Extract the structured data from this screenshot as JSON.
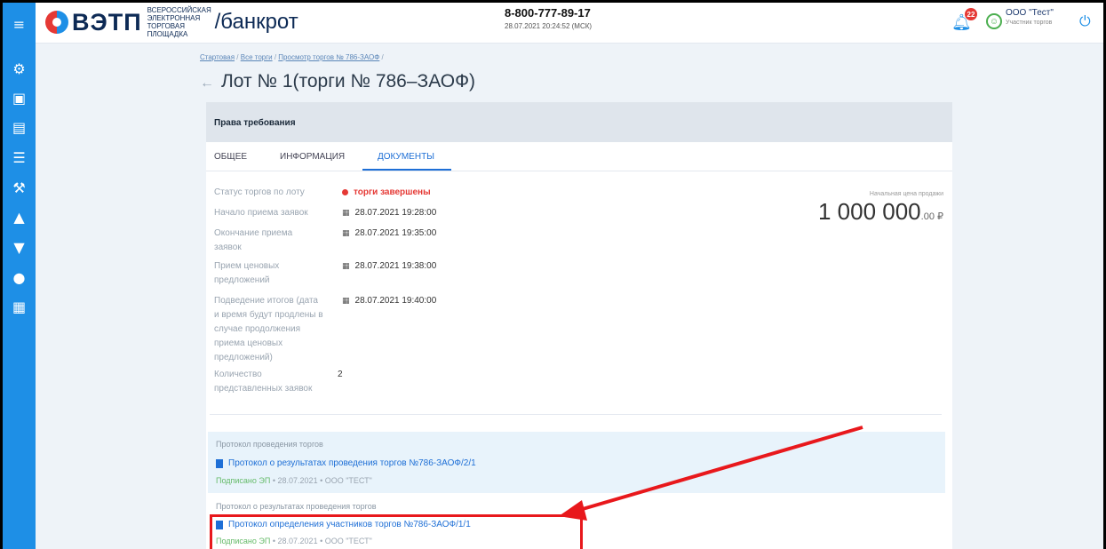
{
  "header": {
    "logo_text": "ВЭТП",
    "logo_sub": "ВСЕРОССИЙСКАЯ ЭЛЕКТРОННАЯ ТОРГОВАЯ ПЛОЩАДКА",
    "logo_section": "/банкрот",
    "phone": "8-800-777-89-17",
    "datetime": "28.07.2021 20:24:52 (МСК)",
    "notifications_count": "22",
    "user_name": "ООО \"Тест\"",
    "user_role": "Участник торгов"
  },
  "sidebar": {
    "icons": [
      "menu-icon",
      "settings-icon",
      "document-icon",
      "scroll-icon",
      "list-icon",
      "gavel-icon",
      "auction-icon",
      "auction2-icon",
      "money-bag-icon",
      "contacts-icon"
    ]
  },
  "breadcrumb": {
    "items": [
      "Стартовая",
      "Все торги",
      "Просмотр торгов № 786-ЗАОФ"
    ]
  },
  "page": {
    "title": "Лот № 1(торги № 786–ЗАОФ)"
  },
  "card": {
    "header": "Права требования",
    "tabs": [
      "ОБЩЕЕ",
      "ИНФОРМАЦИЯ",
      "ДОКУМЕНТЫ"
    ],
    "active_tab": 2,
    "fields": [
      {
        "label": "Статус торгов по лоту",
        "value": "торги завершены"
      },
      {
        "label": "Начало приема заявок",
        "value": "28.07.2021 19:28:00"
      },
      {
        "label": "Окончание приема заявок",
        "value": "28.07.2021 19:35:00"
      },
      {
        "label": "Прием ценовых предложений",
        "value": "28.07.2021 19:38:00"
      },
      {
        "label": "Подведение итогов (дата и время будут продлены в случае продолжения приема ценовых предложений)",
        "value": "28.07.2021 19:40:00"
      },
      {
        "label": "Количество представленных заявок",
        "value": "2"
      }
    ],
    "price_label": "Начальная цена продажи",
    "price_main": "1 000 000",
    "price_cents": ".00 ₽"
  },
  "documents": [
    {
      "section": "Протокол проведения торгов",
      "link": "Протокол о результатах проведения торгов №786-ЗАОФ/2/1",
      "signed": "Подписано ЭП",
      "meta": "• 28.07.2021 • ООО \"ТЕСТ\""
    },
    {
      "section": "Протокол о результатах проведения торгов",
      "link": "Протокол определения участников торгов №786-ЗАОФ/1/1",
      "signed": "Подписано ЭП",
      "meta": "• 28.07.2021 • ООО \"ТЕСТ\""
    }
  ],
  "colors": {
    "accent": "#1e8fe6",
    "status_red": "#e53935",
    "annotation_red": "#e8181c",
    "signed_green": "#66bb6a"
  }
}
